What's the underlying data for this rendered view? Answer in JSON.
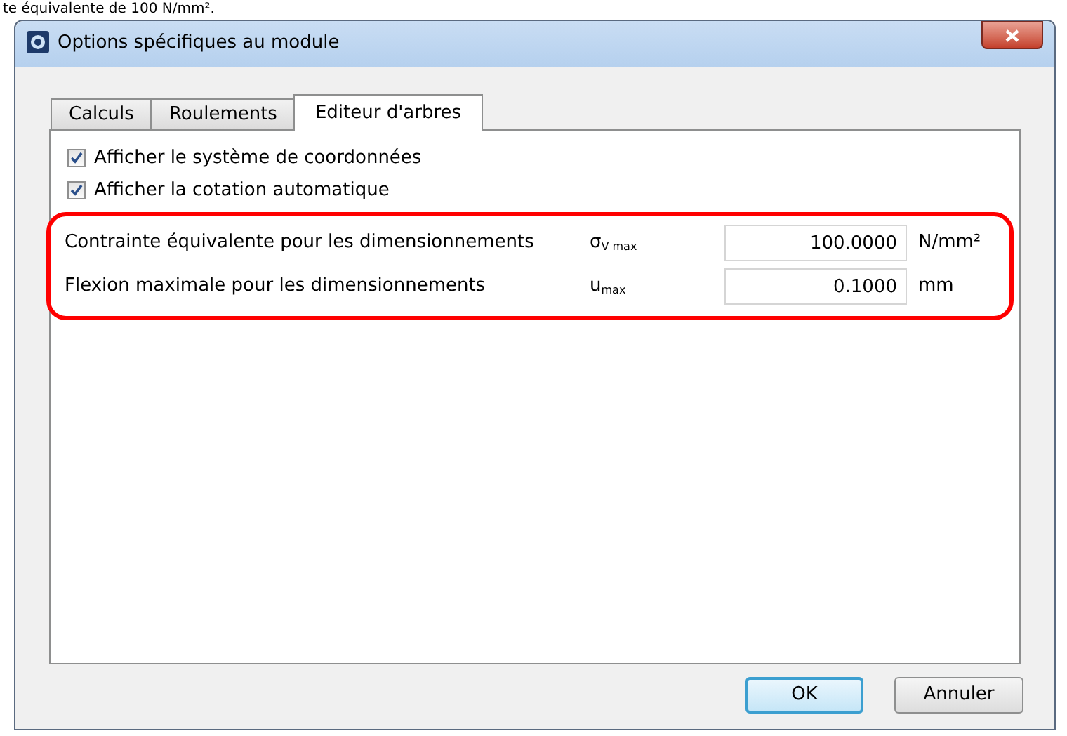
{
  "caption": "te équivalente de 100 N/mm².",
  "window": {
    "title": "Options spécifiques au module"
  },
  "tabs": [
    {
      "label": "Calculs",
      "selected": false
    },
    {
      "label": "Roulements",
      "selected": false
    },
    {
      "label": "Editeur d'arbres",
      "selected": true
    }
  ],
  "checkboxes": [
    {
      "label": "Afficher le système de coordonnées",
      "checked": true
    },
    {
      "label": "Afficher la cotation automatique",
      "checked": true
    }
  ],
  "parameters": [
    {
      "label": "Contrainte équivalente pour les dimensionnements",
      "symbol": "σ$_{V max}$",
      "value": "100.0000",
      "unit": "N/mm²"
    },
    {
      "label": "Flexion maximale pour les dimensionnements",
      "symbol": "u$_{max}$",
      "value": "0.1000",
      "unit": "mm"
    }
  ],
  "buttons": [
    {
      "label": "OK",
      "kind": "default"
    },
    {
      "label": "Annuler",
      "kind": "normal"
    }
  ]
}
